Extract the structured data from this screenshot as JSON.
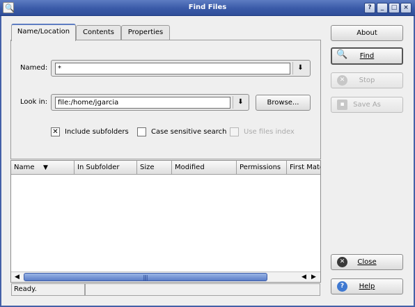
{
  "window": {
    "title": "Find Files",
    "controls": [
      "?",
      "_",
      "□",
      "×"
    ]
  },
  "tabs": [
    {
      "label": "Name/Location",
      "active": true
    },
    {
      "label": "Contents",
      "active": false
    },
    {
      "label": "Properties",
      "active": false
    }
  ],
  "form": {
    "named_label": "Named:",
    "named_value": "*",
    "look_in_label": "Look in:",
    "look_in_value": "file:/home/jgarcia",
    "browse_label": "Browse..."
  },
  "checkboxes": [
    {
      "label": "Include subfolders",
      "checked": true,
      "enabled": true
    },
    {
      "label": "Case sensitive search",
      "checked": false,
      "enabled": true
    },
    {
      "label": "Use files index",
      "checked": false,
      "enabled": false
    }
  ],
  "columns": [
    "Name",
    "In Subfolder",
    "Size",
    "Modified",
    "Permissions",
    "First Match"
  ],
  "side_buttons": {
    "about": "About",
    "find": "Find",
    "stop": "Stop",
    "save_as": "Save As",
    "close": "Close",
    "help": "Help"
  },
  "status": {
    "text": "Ready.",
    "detail": ""
  }
}
